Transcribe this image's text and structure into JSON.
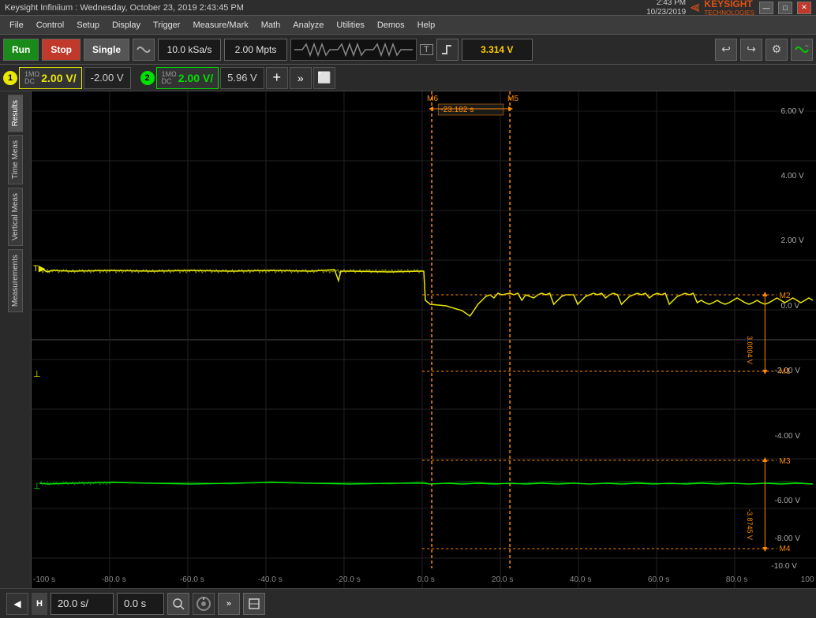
{
  "titleBar": {
    "title": "Keysight Infiniium : Wednesday, October 23, 2019  2:43:45 PM"
  },
  "menuBar": {
    "items": [
      "File",
      "Control",
      "Setup",
      "Display",
      "Trigger",
      "Measure/Mark",
      "Math",
      "Analyze",
      "Utilities",
      "Demos",
      "Help"
    ]
  },
  "logoArea": {
    "datetime": "2:43 PM\n10/23/2019",
    "brand": "KEYSIGHT",
    "sub": "TECHNOLOGIES"
  },
  "toolbar": {
    "run_label": "Run",
    "stop_label": "Stop",
    "single_label": "Single",
    "sample_rate": "10.0 kSa/s",
    "mem_depth": "2.00 Mpts",
    "trig_level": "3.314 V",
    "trig_icon": "T",
    "measure_icon": "~"
  },
  "channels": {
    "ch1": {
      "num": "1",
      "coupling": "1MΩ\nDC",
      "scale": "2.00 V/",
      "offset": "-2.00 V",
      "color": "#e8e800"
    },
    "ch2": {
      "num": "2",
      "coupling": "1MΩ\nDC",
      "scale": "2.00 V/",
      "offset": "5.96 V",
      "color": "#00e000"
    }
  },
  "yAxisLabels": [
    {
      "value": "6.00 V",
      "pct": 4
    },
    {
      "value": "4.00 V",
      "pct": 17
    },
    {
      "value": "2.00 V",
      "pct": 30
    },
    {
      "value": "0.0 V",
      "pct": 43
    },
    {
      "value": "-2.00 V",
      "pct": 56
    },
    {
      "value": "-4.00 V",
      "pct": 69
    },
    {
      "value": "-6.00 V",
      "pct": 81
    },
    {
      "value": "-8.00 V",
      "pct": 89
    },
    {
      "value": "-10.0 V",
      "pct": 97
    }
  ],
  "xAxisLabels": [
    {
      "value": "-100 s",
      "pct": 1
    },
    {
      "value": "-80.0 s",
      "pct": 11
    },
    {
      "value": "-60.0 s",
      "pct": 21
    },
    {
      "value": "-40.0 s",
      "pct": 31
    },
    {
      "value": "-20.0 s",
      "pct": 41
    },
    {
      "value": "0.0 s",
      "pct": 51
    },
    {
      "value": "20.0 s",
      "pct": 61
    },
    {
      "value": "40.0 s",
      "pct": 71
    },
    {
      "value": "60.0 s",
      "pct": 81
    },
    {
      "value": "80.0 s",
      "pct": 91
    },
    {
      "value": "100 s",
      "pct": 99
    }
  ],
  "markers": {
    "m6_label": "M6",
    "m5_label": "M5",
    "m5_time": "-23.182 s",
    "m1_label": "M1",
    "m2_label": "M2",
    "m2_value": "3.0004 V",
    "m3_label": "M3",
    "m3_value": "-3.8745 V",
    "m4_label": "M4"
  },
  "bottomBar": {
    "h_label": "H",
    "timebase": "20.0 s/",
    "offset": "0.0 s"
  },
  "sidebarTabs": [
    "Results",
    "Time Meas",
    "Vertical Meas",
    "Measurements"
  ]
}
